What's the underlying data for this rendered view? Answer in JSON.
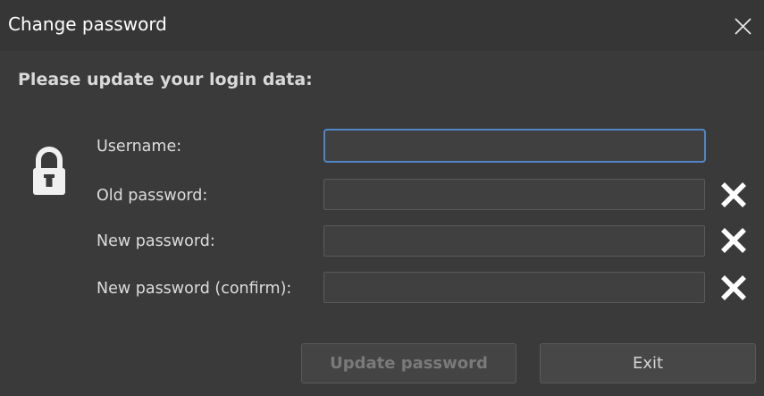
{
  "window": {
    "title": "Change password"
  },
  "form": {
    "heading": "Please update your login data:",
    "fields": [
      {
        "label": "Username:",
        "value": ""
      },
      {
        "label": "Old password:",
        "value": ""
      },
      {
        "label": "New password:",
        "value": ""
      },
      {
        "label": "New password (confirm):",
        "value": ""
      }
    ]
  },
  "buttons": {
    "update_label": "Update password",
    "exit_label": "Exit"
  },
  "icons": {
    "close": "close-icon",
    "lock": "lock-icon",
    "clear": "clear-x-icon"
  },
  "colors": {
    "background": "#3a3a3a",
    "focus_border": "#4f86c6",
    "clear_icon": "#ffffff"
  }
}
